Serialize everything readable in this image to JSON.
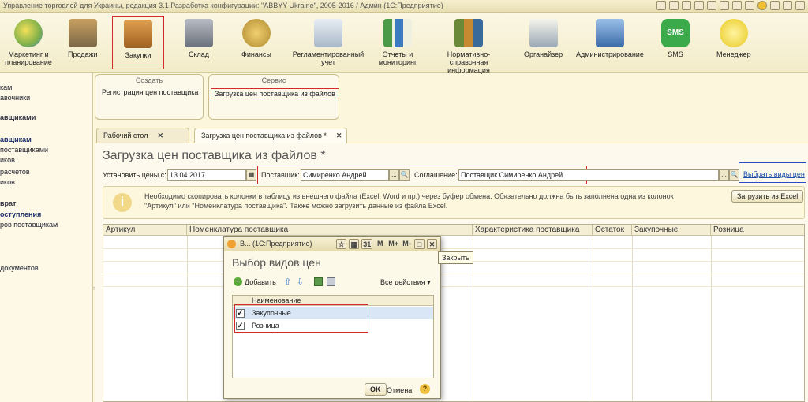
{
  "window": {
    "title": "Управление торговлей для Украины, редакция 3.1 Разработка конфигурации: \"ABBYY Ukraine\", 2005-2016 / Админ (1С:Предприятие)"
  },
  "sections": [
    {
      "label": "Маркетинг и планирование",
      "icon": "pie-chart-icon",
      "color": "#7fb04a"
    },
    {
      "label": "Продажи",
      "icon": "truck-icon",
      "color": "#8a7a5a"
    },
    {
      "label": "Закупки",
      "icon": "boxes-icon",
      "color": "#c2803a"
    },
    {
      "label": "Склад",
      "icon": "shelves-icon",
      "color": "#8a8f9a"
    },
    {
      "label": "Финансы",
      "icon": "coins-icon",
      "color": "#c8a840"
    },
    {
      "label": "Регламентированный учет",
      "icon": "documents-icon",
      "color": "#a8b8c8"
    },
    {
      "label": "Отчеты и мониторинг",
      "icon": "bar-chart-icon",
      "color": "#4a9a4a"
    },
    {
      "label": "Нормативно-справочная информация",
      "icon": "binders-icon",
      "color": "#6a8a3a"
    },
    {
      "label": "Органайзер",
      "icon": "clipboard-icon",
      "color": "#8a9aaa"
    },
    {
      "label": "Администрирование",
      "icon": "computer-icon",
      "color": "#5a8ac8"
    },
    {
      "label": "SMS",
      "icon": "sms-icon",
      "color": "#3aaa4a"
    },
    {
      "label": "Менеджер",
      "icon": "manager-icon",
      "color": "#e8d040"
    }
  ],
  "leftnav": [
    {
      "text": "кам",
      "style": ""
    },
    {
      "text": "авочники",
      "style": ""
    },
    {
      "text": "авщиками",
      "style": "b"
    },
    {
      "text": "авщикам",
      "style": "sel"
    },
    {
      "text": "поставщиками",
      "style": ""
    },
    {
      "text": "иков",
      "style": ""
    },
    {
      "text": "расчетов",
      "style": ""
    },
    {
      "text": "иков",
      "style": ""
    },
    {
      "text": "врат",
      "style": "b"
    },
    {
      "text": "оступления",
      "style": "sel"
    },
    {
      "text": "ров поставщикам",
      "style": ""
    },
    {
      "text": "документов",
      "style": ""
    }
  ],
  "groups": {
    "create": {
      "header": "Создать",
      "item": "Регистрация цен поставщика"
    },
    "service": {
      "header": "Сервис",
      "item": "Загрузка цен поставщика из файлов"
    }
  },
  "tabs": {
    "desktop": "Рабочий стол",
    "form": "Загрузка цен поставщика из файлов *"
  },
  "form": {
    "title": "Загрузка цен поставщика из файлов *",
    "set_prices_label": "Установить цены с:",
    "date_value": "13.04.2017",
    "supplier_label": "Поставщик:",
    "supplier_value": "Симиренко Андрей",
    "agreement_label": "Соглашение:",
    "agreement_value": "Поставщик Симиренко Андрей",
    "choose_price_types": "Выбрать виды цен",
    "info_text": "Необходимо скопировать колонки в таблицу из внешнего файла (Excel, Word и пр.) через буфер обмена. Обязательно должна быть заполнена одна из колонок \"Артикул\" или \"Номенклатура поставщика\". Также можно загрузить данные из файла Excel.",
    "load_excel_button": "Загрузить из Excel",
    "dots": "...",
    "search_glyph": "🔍"
  },
  "grid": {
    "columns": [
      "Артикул",
      "Номенклатура поставщика",
      "Характеристика поставщика",
      "Остаток",
      "Закупочные",
      "Розница"
    ]
  },
  "dialog": {
    "window_title": "В... (1С:Предприятие)",
    "buttons": {
      "m": "M",
      "mplus": "M+",
      "mminus": "M-"
    },
    "title": "Выбор видов цен",
    "add_button": "Добавить",
    "all_actions": "Все действия ▾",
    "list_header": "Наименование",
    "rows": [
      {
        "name": "Закупочные",
        "checked": true
      },
      {
        "name": "Розница",
        "checked": true
      }
    ],
    "ok_button": "OK",
    "cancel_button": "Отмена",
    "help": "?",
    "tooltip": "Закрыть"
  },
  "colors": {
    "highlight_red": "#d62a2a",
    "background": "#fbf6dc",
    "link_blue": "#1d4fa8"
  }
}
